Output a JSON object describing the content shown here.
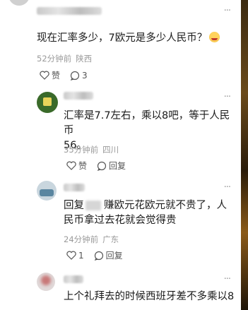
{
  "comments": [
    {
      "text": "现在汇率多少，7欧元是多少人民币？",
      "time": "52分钟前",
      "location": "陕西",
      "like_label": "赞",
      "reply_count": "3"
    },
    {
      "text_line1": "汇率是7.7左右，乘以8吧，等于人民币",
      "text_line2": "56。",
      "time": "35分钟前",
      "location": "四川",
      "like_label": "赞",
      "reply_label": "回复"
    },
    {
      "reply_prefix": "回复",
      "text_line1": "赚欧元花欧元就不贵了，人",
      "text_line2": "民币拿过去花就会觉得贵",
      "time": "24分钟前",
      "location": "广东",
      "like_count": "1",
      "reply_label": "回复"
    },
    {
      "text": "上个礼拜去的时候西班牙差不多乘以8"
    }
  ],
  "more_label": "···"
}
